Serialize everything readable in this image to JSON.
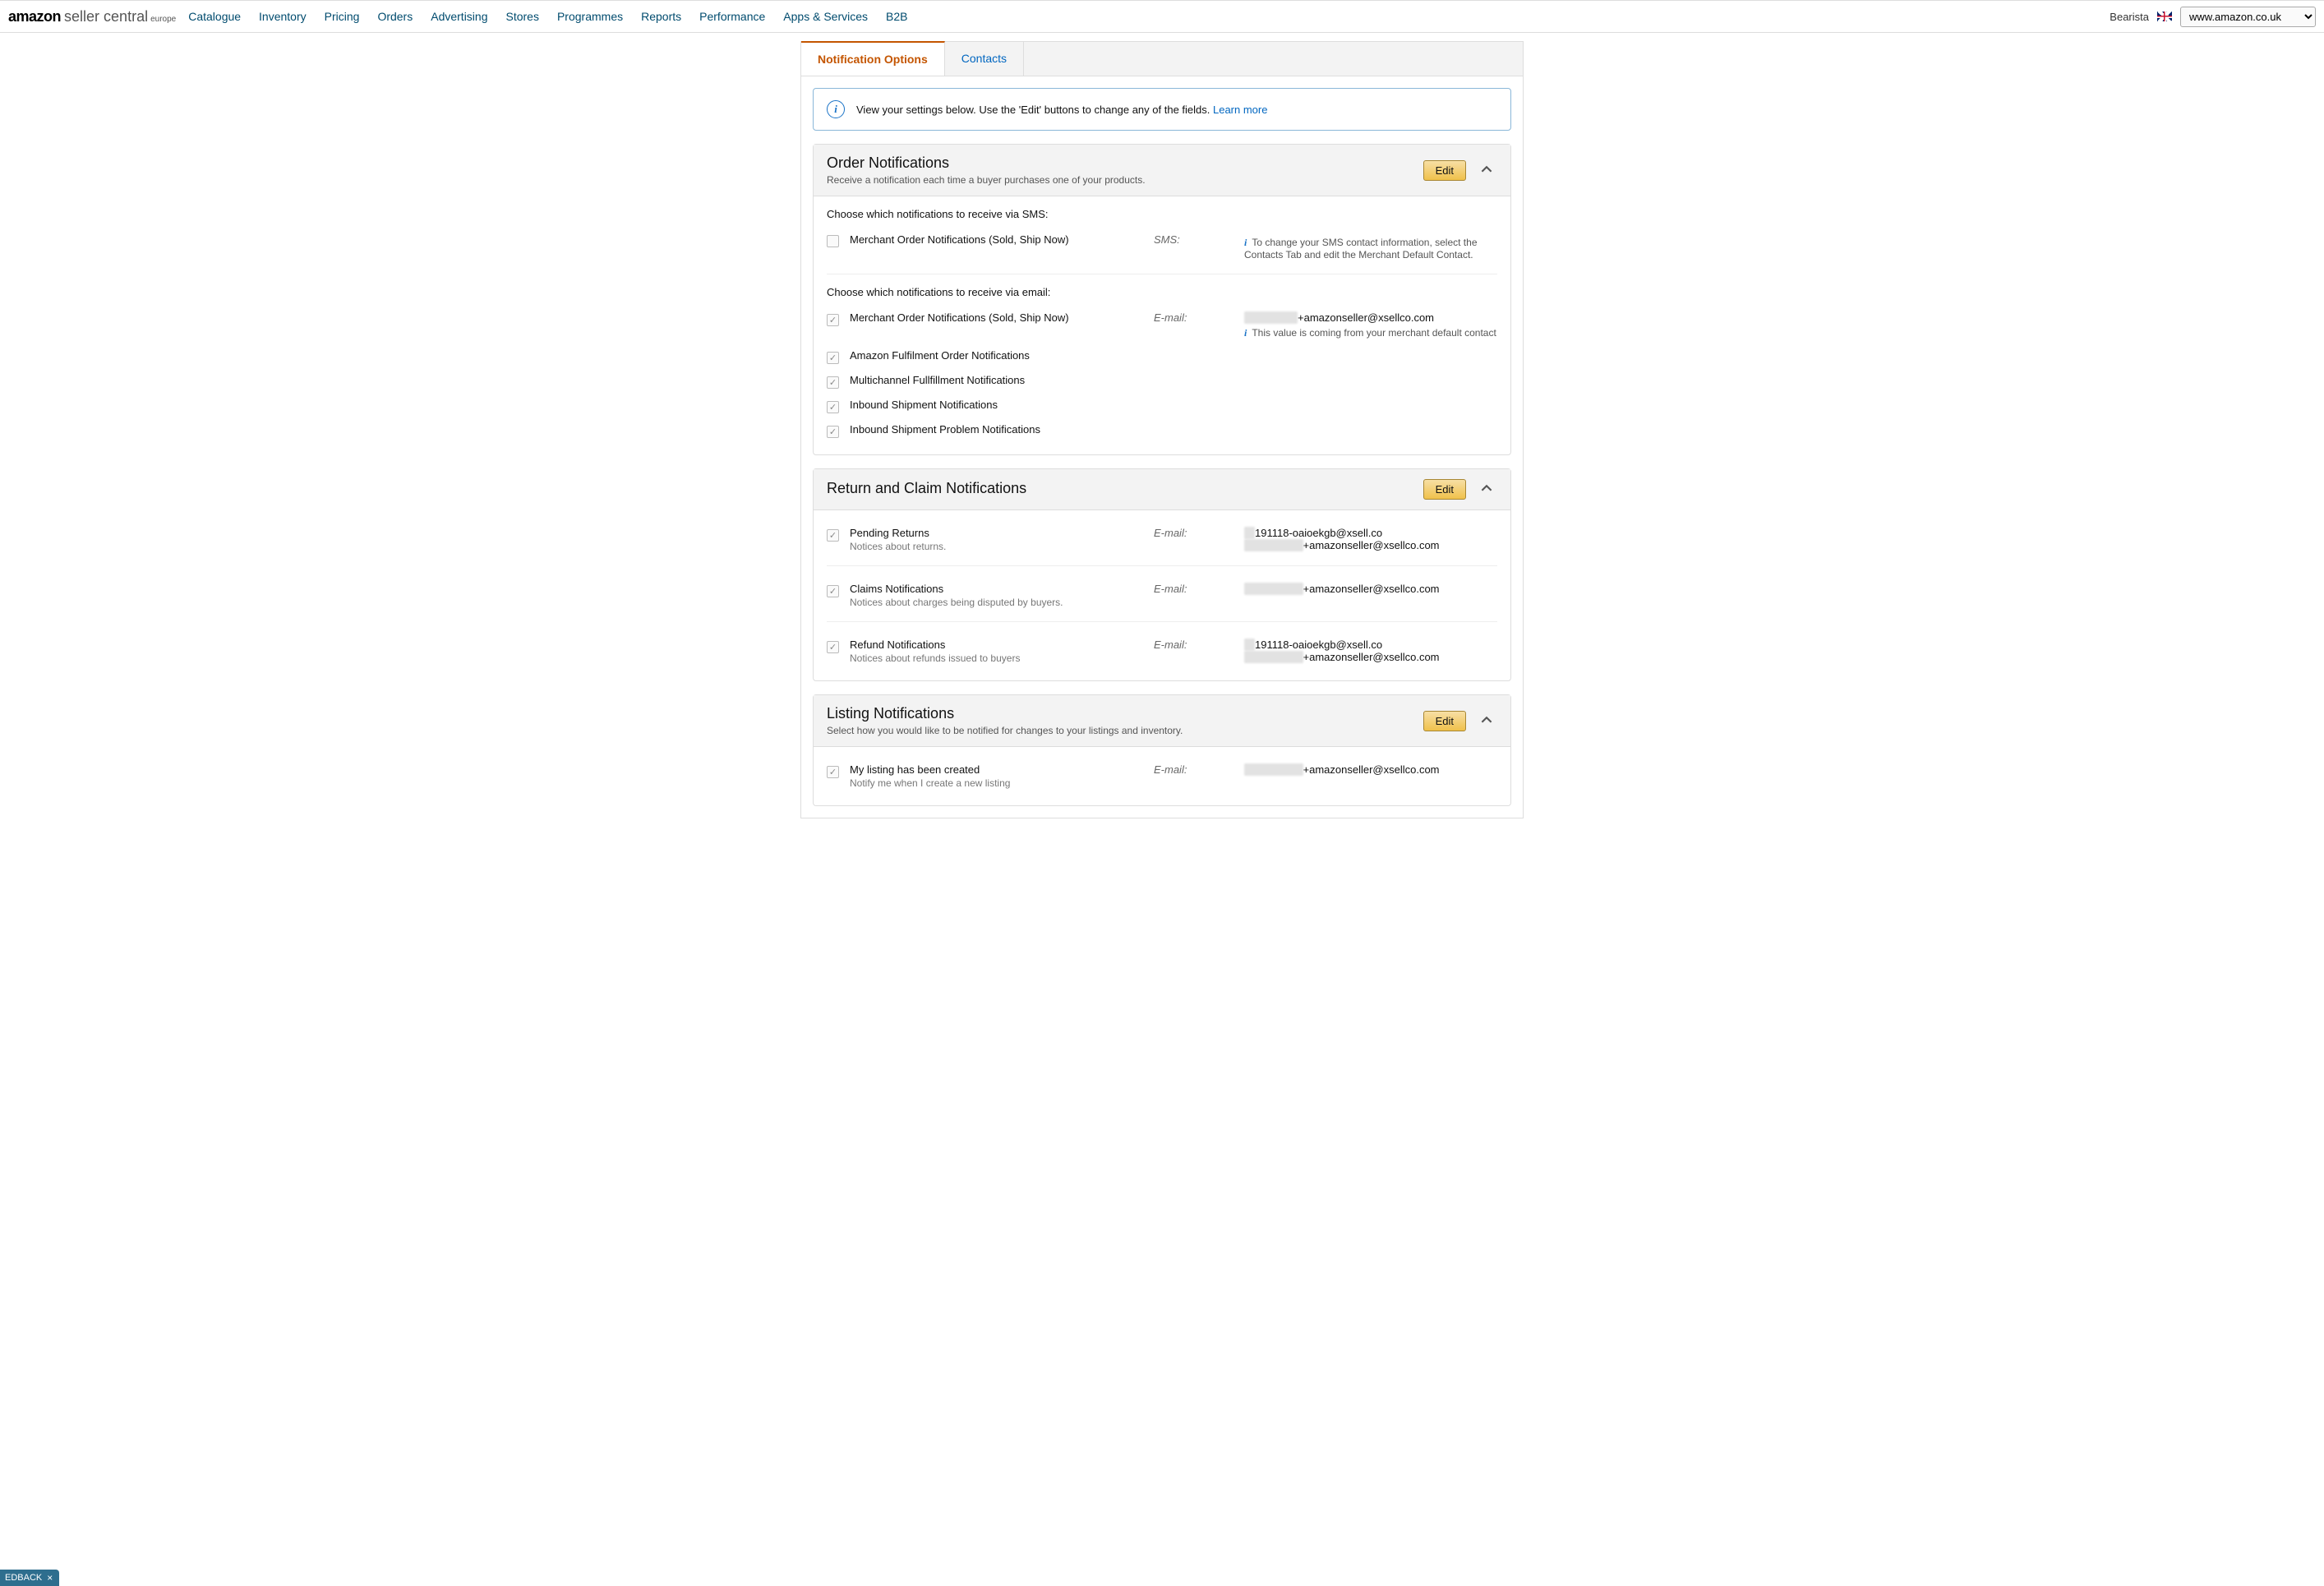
{
  "header": {
    "logo_main": "amazon",
    "logo_sub": "seller central",
    "logo_region": "europe",
    "nav": [
      "Catalogue",
      "Inventory",
      "Pricing",
      "Orders",
      "Advertising",
      "Stores",
      "Programmes",
      "Reports",
      "Performance",
      "Apps & Services",
      "B2B"
    ],
    "user": "Bearista",
    "marketplace": "www.amazon.co.uk"
  },
  "tabs": {
    "notification_options": "Notification Options",
    "contacts": "Contacts"
  },
  "alert": {
    "text": "View your settings below. Use the 'Edit' buttons to change any of the fields. ",
    "link": "Learn more"
  },
  "sections": {
    "order": {
      "title": "Order Notifications",
      "sub": "Receive a notification each time a buyer purchases one of your products.",
      "edit": "Edit",
      "sms_head": "Choose which notifications to receive via SMS:",
      "sms_item": "Merchant Order Notifications (Sold, Ship Now)",
      "sms_chan": "SMS:",
      "sms_note": "To change your SMS contact information, select the Contacts Tab and edit the Merchant Default Contact.",
      "email_head": "Choose which notifications to receive via email:",
      "email_items": [
        "Merchant Order Notifications (Sold, Ship Now)",
        "Amazon Fulfilment Order Notifications",
        "Multichannel Fullfillment Notifications",
        "Inbound Shipment Notifications",
        "Inbound Shipment Problem Notifications"
      ],
      "email_chan": "E-mail:",
      "email_val_prefix": "xxxxxxxxxx",
      "email_val_suffix": "+amazonseller@xsellco.com",
      "email_note": "This value is coming from your merchant default contact"
    },
    "return": {
      "title": "Return and Claim Notifications",
      "edit": "Edit",
      "chan": "E-mail:",
      "items": [
        {
          "title": "Pending Returns",
          "desc": "Notices about returns.",
          "emails": [
            {
              "prefix": "xx",
              "text": "191118-oaioekgb@xsell.co"
            },
            {
              "prefix": "xxxxxxxxxxx",
              "text": "+amazonseller@xsellco.com"
            }
          ]
        },
        {
          "title": "Claims Notifications",
          "desc": "Notices about charges being disputed by buyers.",
          "emails": [
            {
              "prefix": "xxxxxxxxxxx",
              "text": "+amazonseller@xsellco.com"
            }
          ]
        },
        {
          "title": "Refund Notifications",
          "desc": "Notices about refunds issued to buyers",
          "emails": [
            {
              "prefix": "xx",
              "text": "191118-oaioekgb@xsell.co"
            },
            {
              "prefix": "xxxxxxxxxxx",
              "text": "+amazonseller@xsellco.com"
            }
          ]
        }
      ]
    },
    "listing": {
      "title": "Listing Notifications",
      "sub": "Select how you would like to be notified for changes to your listings and inventory.",
      "edit": "Edit",
      "chan": "E-mail:",
      "item_title": "My listing has been created",
      "item_desc": "Notify me when I create a new listing",
      "email_prefix": "xxxxxxxxxxx",
      "email_suffix": "+amazonseller@xsellco.com"
    }
  },
  "feedback": "EDBACK"
}
